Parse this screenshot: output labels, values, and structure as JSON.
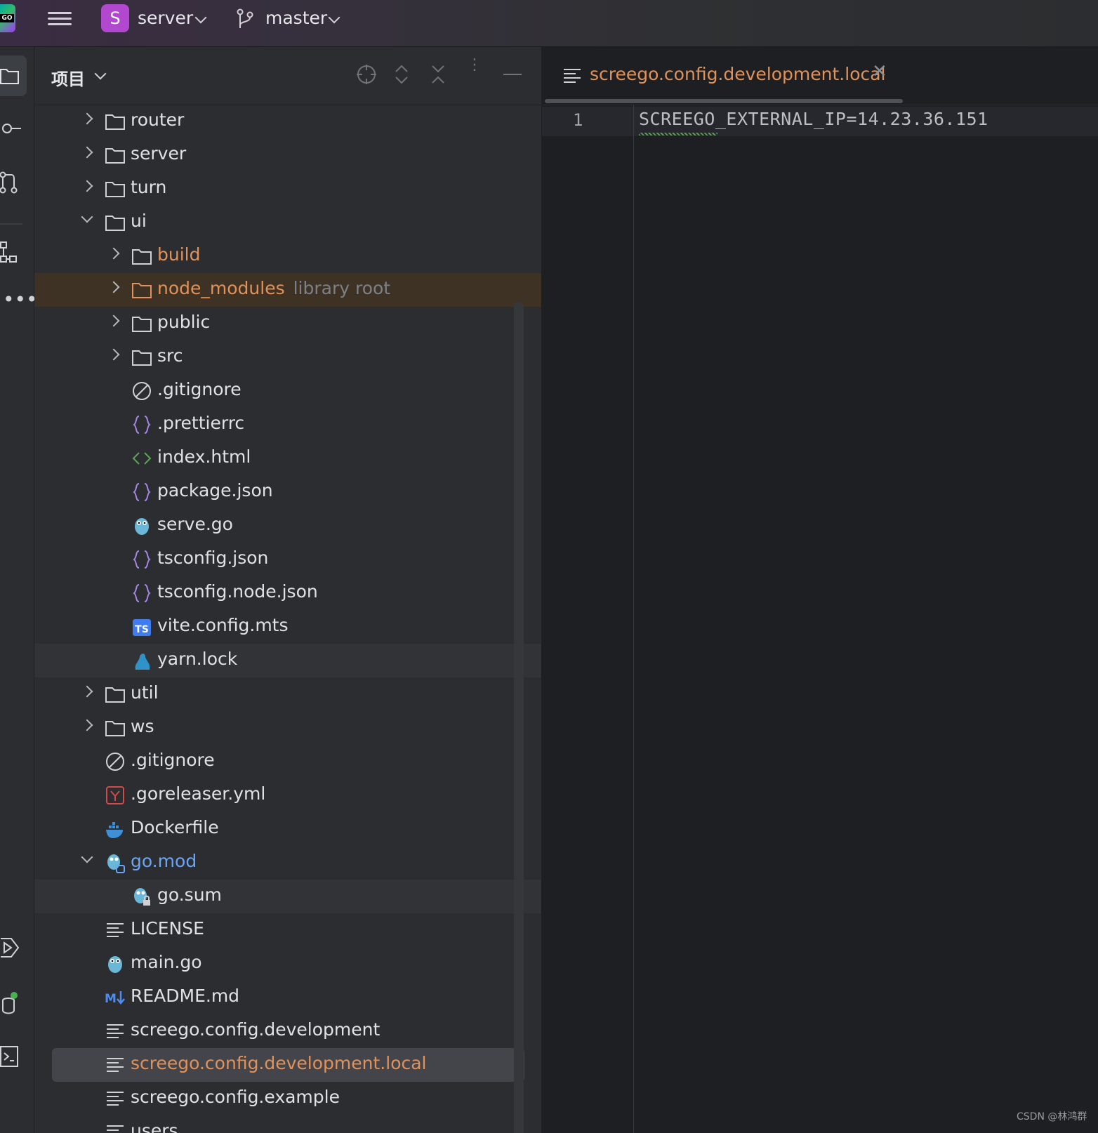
{
  "titlebar": {
    "app_logo_text": "GO",
    "project_initial": "S",
    "project_name": "server",
    "branch_name": "master"
  },
  "project_panel": {
    "title": "项目",
    "icons": [
      "crosshair-icon",
      "expand-all-icon",
      "collapse-all-icon",
      "more-icon",
      "minimize-icon"
    ]
  },
  "tree": [
    {
      "label": "router",
      "icon": "folder",
      "depth": 1,
      "arrow": "right"
    },
    {
      "label": "server",
      "icon": "folder",
      "depth": 1,
      "arrow": "right"
    },
    {
      "label": "turn",
      "icon": "folder",
      "depth": 1,
      "arrow": "right"
    },
    {
      "label": "ui",
      "icon": "folder",
      "depth": 1,
      "arrow": "down"
    },
    {
      "label": "build",
      "icon": "folder",
      "depth": 2,
      "arrow": "right",
      "color": "orange"
    },
    {
      "label": "node_modules",
      "sub": "library root",
      "icon": "folder-lib",
      "depth": 2,
      "arrow": "right",
      "color": "orange",
      "state": "lib"
    },
    {
      "label": "public",
      "icon": "folder",
      "depth": 2,
      "arrow": "right"
    },
    {
      "label": "src",
      "icon": "folder",
      "depth": 2,
      "arrow": "right"
    },
    {
      "label": ".gitignore",
      "icon": "ignore",
      "depth": 2
    },
    {
      "label": ".prettierrc",
      "icon": "json",
      "depth": 2
    },
    {
      "label": "index.html",
      "icon": "html",
      "depth": 2
    },
    {
      "label": "package.json",
      "icon": "json",
      "depth": 2
    },
    {
      "label": "serve.go",
      "icon": "go",
      "depth": 2
    },
    {
      "label": "tsconfig.json",
      "icon": "json",
      "depth": 2
    },
    {
      "label": "tsconfig.node.json",
      "icon": "json",
      "depth": 2
    },
    {
      "label": "vite.config.mts",
      "icon": "ts",
      "depth": 2
    },
    {
      "label": "yarn.lock",
      "icon": "yarn",
      "depth": 2,
      "state": "hl"
    },
    {
      "label": "util",
      "icon": "folder",
      "depth": 1,
      "arrow": "right"
    },
    {
      "label": "ws",
      "icon": "folder",
      "depth": 1,
      "arrow": "right"
    },
    {
      "label": ".gitignore",
      "icon": "ignore",
      "depth": 1
    },
    {
      "label": ".goreleaser.yml",
      "icon": "yaml",
      "depth": 1
    },
    {
      "label": "Dockerfile",
      "icon": "docker",
      "depth": 1
    },
    {
      "label": "go.mod",
      "icon": "gomod",
      "depth": 1,
      "arrow": "down",
      "color": "blue"
    },
    {
      "label": "go.sum",
      "icon": "gosum",
      "depth": 2,
      "state": "hl"
    },
    {
      "label": "LICENSE",
      "icon": "text",
      "depth": 1
    },
    {
      "label": "main.go",
      "icon": "go",
      "depth": 1
    },
    {
      "label": "README.md",
      "icon": "md",
      "depth": 1
    },
    {
      "label": "screego.config.development",
      "icon": "text",
      "depth": 1
    },
    {
      "label": "screego.config.development.local",
      "icon": "text",
      "depth": 1,
      "color": "orange",
      "state": "sel"
    },
    {
      "label": "screego.config.example",
      "icon": "text",
      "depth": 1
    },
    {
      "label": "users",
      "icon": "text",
      "depth": 1
    }
  ],
  "editor": {
    "tab_label": "screego.config.development.local",
    "line_number": "1",
    "code_line": "SCREEGO_EXTERNAL_IP=14.23.36.151"
  },
  "watermark": "CSDN @林鸿群",
  "colors": {
    "accent_orange": "#e0925a",
    "accent_blue": "#6ba6f5",
    "panel_bg": "#2b2d30",
    "editor_bg": "#1e1f22",
    "project_avatar": "#b348d0"
  }
}
